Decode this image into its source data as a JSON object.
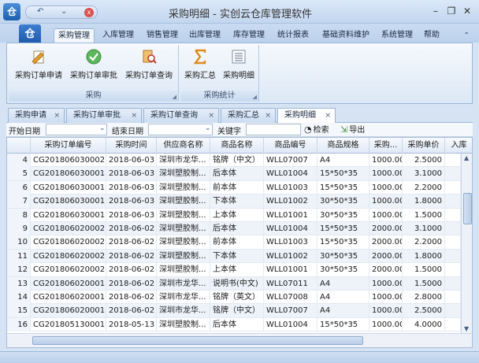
{
  "window": {
    "title": "采购明细 - 实创云仓库管理软件",
    "logo_text": "仓",
    "controls": {
      "minimize": "–",
      "restore": "❐",
      "close": "✕"
    }
  },
  "qat": {
    "prev": "↶",
    "next": "⌄",
    "close": "x"
  },
  "ribbon": {
    "file_button": "仓",
    "tabs": [
      "采购管理",
      "入库管理",
      "销售管理",
      "出库管理",
      "库存管理",
      "统计报表",
      "基础资料维护",
      "系统管理",
      "帮助"
    ],
    "active_tab": "采购管理",
    "groups": [
      {
        "label": "采购",
        "buttons": [
          {
            "label": "采购订单申请",
            "icon": "pencil-doc-icon"
          },
          {
            "label": "采购订单审批",
            "icon": "check-circle-icon"
          },
          {
            "label": "采购订单查询",
            "icon": "search-doc-icon"
          }
        ]
      },
      {
        "label": "采购统计",
        "buttons": [
          {
            "label": "采购汇总",
            "icon": "sigma-icon"
          },
          {
            "label": "采购明细",
            "icon": "list-icon"
          }
        ]
      }
    ],
    "pin": "⌃"
  },
  "doc_tabs": [
    "采购申请",
    "采购订单审批",
    "采购订单查询",
    "采购汇总",
    "采购明细"
  ],
  "active_doc_tab": "采购明细",
  "filters": {
    "start_date_label": "开始日期",
    "end_date_label": "结束日期",
    "keyword_label": "关键字",
    "search_button": "检索",
    "export_button": "导出",
    "drop_glyph": "⌄"
  },
  "table": {
    "columns": [
      "",
      "采购订单编号",
      "采购时间",
      "供应商名称",
      "商品名称",
      "商品编号",
      "商品规格",
      "采购...",
      "采购单价",
      "入库"
    ],
    "rows": [
      [
        "4",
        "CG201806030002",
        "2018-06-03",
        "深圳市龙华...",
        "铭牌（中文）",
        "WLL07007",
        "A4",
        "1000.00",
        "2.5000",
        ""
      ],
      [
        "5",
        "CG201806030001",
        "2018-06-03",
        "深圳塑胶制...",
        "后本体",
        "WLL01004",
        "15*50*35",
        "1000.00",
        "3.1000",
        ""
      ],
      [
        "6",
        "CG201806030001",
        "2018-06-03",
        "深圳塑胶制...",
        "前本体",
        "WLL01003",
        "15*50*35",
        "1000.00",
        "2.2000",
        ""
      ],
      [
        "7",
        "CG201806030001",
        "2018-06-03",
        "深圳塑胶制...",
        "下本体",
        "WLL01002",
        "30*50*35",
        "1000.00",
        "1.8000",
        ""
      ],
      [
        "8",
        "CG201806030001",
        "2018-06-03",
        "深圳塑胶制...",
        "上本体",
        "WLL01001",
        "30*50*35",
        "1000.00",
        "1.5000",
        ""
      ],
      [
        "9",
        "CG201806020002",
        "2018-06-02",
        "深圳塑胶制...",
        "后本体",
        "WLL01004",
        "15*50*35",
        "2000.00",
        "3.1000",
        ""
      ],
      [
        "10",
        "CG201806020002",
        "2018-06-02",
        "深圳塑胶制...",
        "前本体",
        "WLL01003",
        "15*50*35",
        "2000.00",
        "2.2000",
        ""
      ],
      [
        "11",
        "CG201806020002",
        "2018-06-02",
        "深圳塑胶制...",
        "下本体",
        "WLL01002",
        "30*50*35",
        "2000.00",
        "1.8000",
        ""
      ],
      [
        "12",
        "CG201806020002",
        "2018-06-02",
        "深圳塑胶制...",
        "上本体",
        "WLL01001",
        "30*50*35",
        "2000.00",
        "1.5000",
        ""
      ],
      [
        "13",
        "CG201806020001",
        "2018-06-02",
        "深圳市龙华...",
        "说明书(中文)",
        "WLL07011",
        "A4",
        "1000.00",
        "1.5000",
        ""
      ],
      [
        "14",
        "CG201806020001",
        "2018-06-02",
        "深圳市龙华...",
        "铭牌（英文）",
        "WLL07008",
        "A4",
        "1000.00",
        "2.8000",
        ""
      ],
      [
        "15",
        "CG201806020001",
        "2018-06-02",
        "深圳市龙华...",
        "铭牌（中文）",
        "WLL07007",
        "A4",
        "1000.00",
        "2.5000",
        ""
      ],
      [
        "16",
        "CG201805130001",
        "2018-05-13",
        "深圳塑胶制...",
        "后本体",
        "WLL01004",
        "15*50*35",
        "1000.00",
        "4.0000",
        ""
      ]
    ]
  },
  "colors": {
    "ribbon_blue": "#1d58a8",
    "accent_red": "#d9534f",
    "row_alt": "#eef3fa"
  }
}
